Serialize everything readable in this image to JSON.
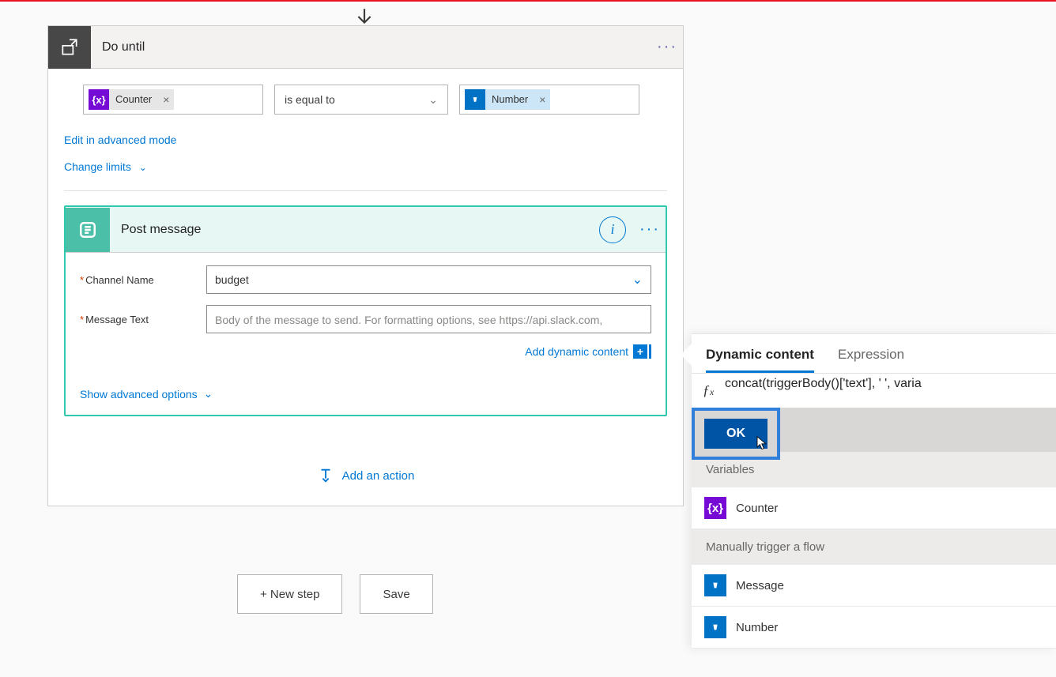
{
  "doUntil": {
    "title": "Do until",
    "leftToken": {
      "label": "Counter"
    },
    "operator": "is equal to",
    "rightToken": {
      "label": "Number"
    },
    "editAdvancedLink": "Edit in advanced mode",
    "changeLimitsLink": "Change limits"
  },
  "postMessage": {
    "title": "Post message",
    "channel": {
      "label": "Channel Name",
      "value": "budget"
    },
    "message": {
      "label": "Message Text",
      "placeholder": "Body of the message to send. For formatting options, see https://api.slack.com,"
    },
    "addDynamic": "Add dynamic content",
    "advancedOptions": "Show advanced options"
  },
  "addAction": "Add an action",
  "buttons": {
    "newStep": "+ New step",
    "save": "Save"
  },
  "dynamicContent": {
    "tabs": {
      "dynamic": "Dynamic content",
      "expression": "Expression"
    },
    "expression": "concat(triggerBody()['text'], ' ', varia",
    "ok": "OK",
    "sections": {
      "variables": "Variables",
      "variablesItems": [
        {
          "label": "Counter",
          "icon": "purple"
        }
      ],
      "trigger": "Manually trigger a flow",
      "triggerItems": [
        {
          "label": "Message",
          "icon": "blue"
        },
        {
          "label": "Number",
          "icon": "blue"
        }
      ]
    }
  }
}
